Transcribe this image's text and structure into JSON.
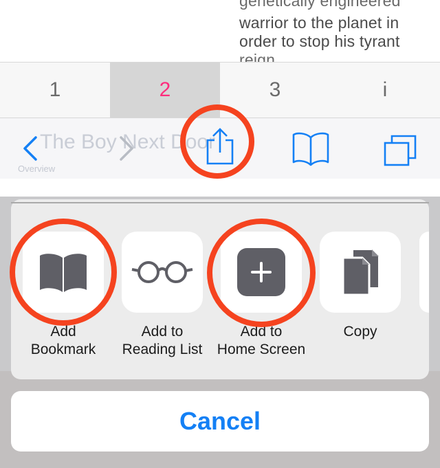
{
  "article": {
    "lines": [
      "genetically engineered",
      "warrior to the planet in",
      "order to stop his tyrant",
      "reign."
    ]
  },
  "tabs": [
    {
      "label": "1"
    },
    {
      "label": "2"
    },
    {
      "label": "3"
    },
    {
      "label": "i"
    }
  ],
  "toolbar": {
    "ghost_title": "The Boy Next Door",
    "ghost_subtitle": "Overview"
  },
  "share_sheet": {
    "actions": [
      {
        "label": "Add\nBookmark",
        "icon": "book-icon"
      },
      {
        "label": "Add to\nReading List",
        "icon": "glasses-icon"
      },
      {
        "label": "Add to\nHome Screen",
        "icon": "plus-icon"
      },
      {
        "label": "Copy",
        "icon": "copy-icon"
      }
    ],
    "cancel_label": "Cancel"
  },
  "colors": {
    "accent_blue": "#1480f5",
    "active_tab_pink": "#ff2d7d",
    "annotation_red": "#f5431f"
  }
}
